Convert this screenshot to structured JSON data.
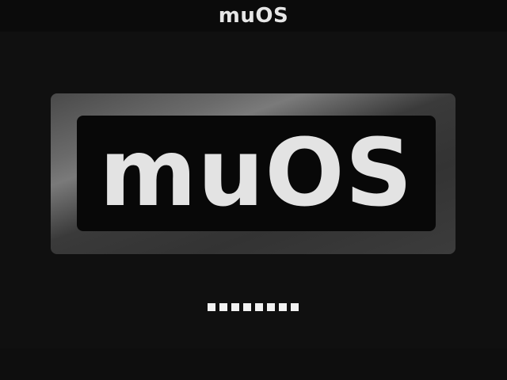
{
  "header": {
    "title": "muOS"
  },
  "boot_logo": {
    "text": "muOS"
  },
  "loading": {
    "dot_count": 8,
    "label": ""
  },
  "colors": {
    "background": "#101010",
    "header_background": "#0b0b0b",
    "text": "#e6e6e6",
    "progress_dot": "#f2f2f2"
  }
}
